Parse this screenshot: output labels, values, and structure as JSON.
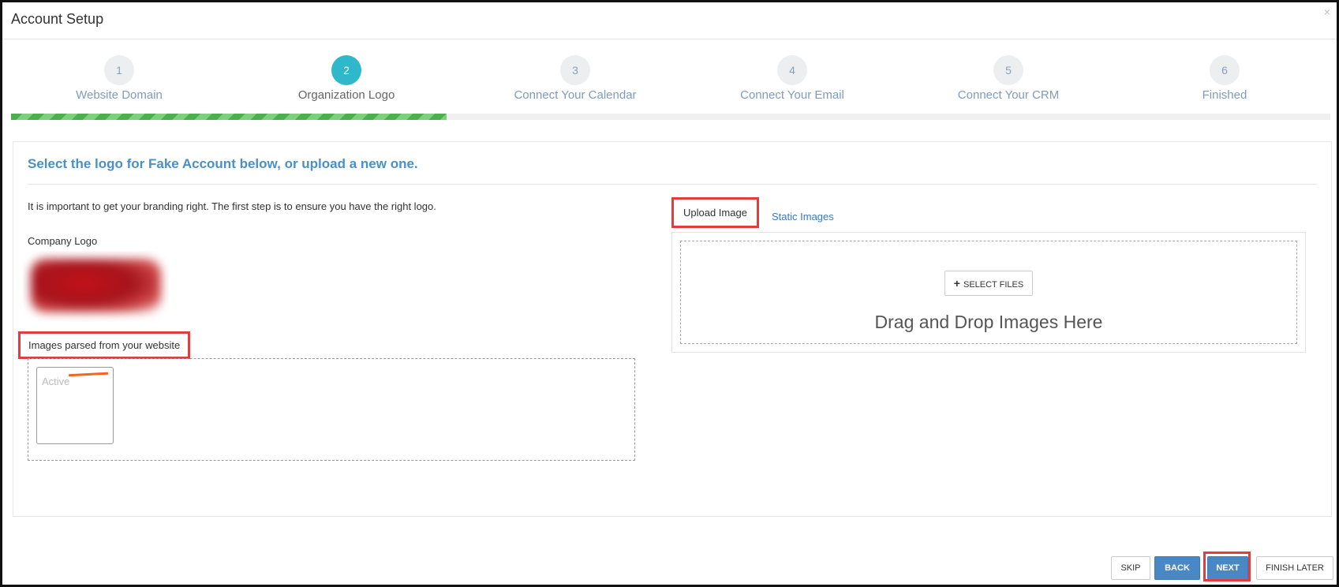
{
  "dialog": {
    "title": "Account Setup",
    "close": "×"
  },
  "steps": [
    {
      "number": "1",
      "label": "Website Domain"
    },
    {
      "number": "2",
      "label": "Organization Logo"
    },
    {
      "number": "3",
      "label": "Connect Your Calendar"
    },
    {
      "number": "4",
      "label": "Connect Your Email"
    },
    {
      "number": "5",
      "label": "Connect Your CRM"
    },
    {
      "number": "6",
      "label": "Finished"
    }
  ],
  "progress": {
    "active_step": 2,
    "fraction": 0.33
  },
  "panel": {
    "heading": "Select the logo for Fake Account below, or upload a new one.",
    "intro": "It is important to get your branding right. The first step is to ensure you have the right logo.",
    "company_logo_label": "Company Logo",
    "parsed_label": "Images parsed from your website",
    "parsed_thumb_text": "Active"
  },
  "upload": {
    "tab_upload": "Upload Image",
    "tab_static": "Static Images",
    "select_files": "SELECT FILES",
    "drag_text": "Drag and Drop Images Here"
  },
  "footer": {
    "skip": "SKIP",
    "back": "BACK",
    "next": "NEXT",
    "finish_later": "FINISH LATER"
  },
  "colors": {
    "accent": "#4a90c8",
    "active_step": "#2fb8cb",
    "progress": "#4cae4c",
    "primary_button": "#4a87c5",
    "highlight": "#e23c3c"
  }
}
